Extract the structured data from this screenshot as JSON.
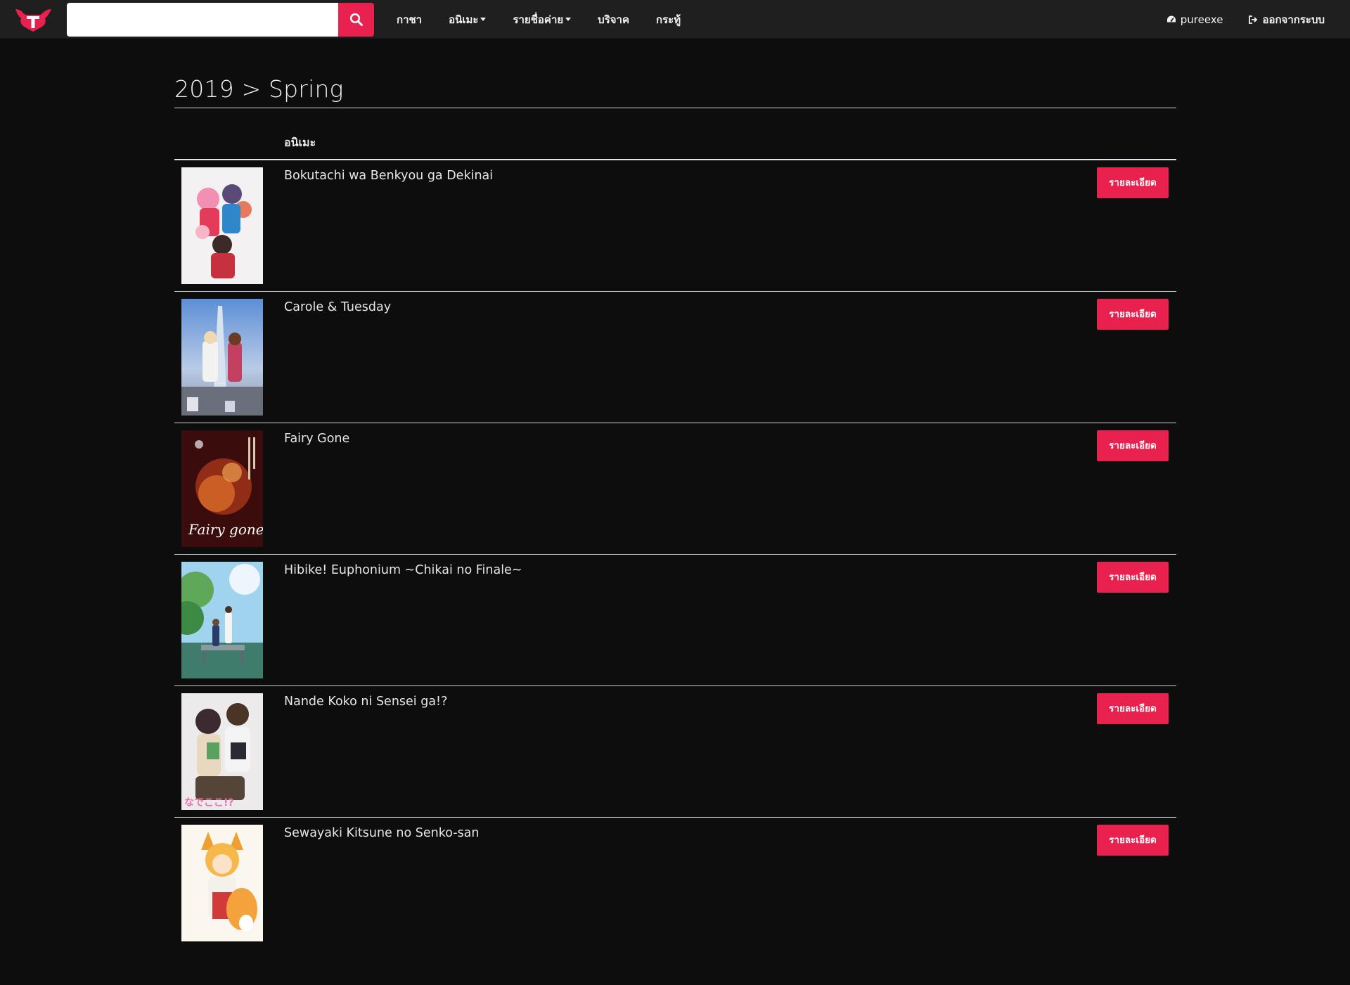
{
  "navbar": {
    "search": {
      "value": "",
      "placeholder": ""
    },
    "links": [
      {
        "label": "กาชา"
      },
      {
        "label": "อนิเมะ"
      },
      {
        "label": "รายชื่อค่าย"
      },
      {
        "label": "บริจาค"
      },
      {
        "label": "กระทู้"
      }
    ],
    "user": {
      "name": "pureexe",
      "icon": "dashboard-icon"
    },
    "logout": {
      "label": "ออกจากระบบ",
      "icon": "sign-out-icon"
    }
  },
  "page": {
    "title": "2019 > Spring",
    "table_header": {
      "anime": "อนิเมะ"
    },
    "detail_label": "รายละเอียด",
    "items": [
      {
        "name": "Bokutachi wa Benkyou ga Dekinai"
      },
      {
        "name": "Carole & Tuesday"
      },
      {
        "name": "Fairy Gone"
      },
      {
        "name": "Hibike! Euphonium ~Chikai no Finale~"
      },
      {
        "name": "Nande Koko ni Sensei ga!?"
      },
      {
        "name": "Sewayaki Kitsune no Senko-san"
      }
    ]
  },
  "colors": {
    "accent": "#e8214f",
    "background": "#0d0d0d",
    "navbar": "#1f1f1f"
  }
}
